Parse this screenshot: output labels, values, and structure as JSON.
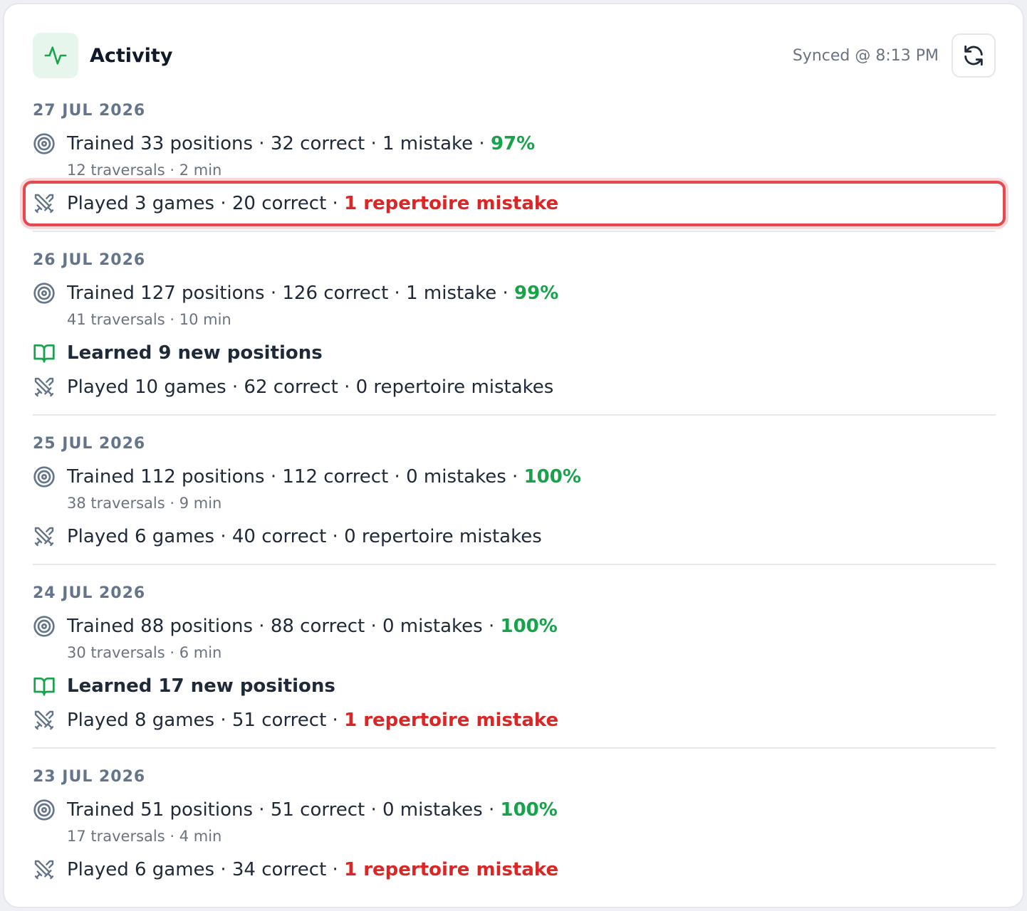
{
  "header": {
    "title": "Activity",
    "sync_text": "Synced @ 8:13 PM",
    "icon": "activity-pulse-icon",
    "refresh_icon": "refresh-icon"
  },
  "colors": {
    "good": "#16a34a",
    "bad": "#dc2626",
    "highlight": "#e5484d"
  },
  "days": [
    {
      "date": "27 JUL 2026",
      "trained": {
        "main": "Trained 33 positions · 32 correct · 1 mistake · ",
        "pct": "97%",
        "sub": "12 traversals · 2 min"
      },
      "played": {
        "main": "Played 3 games · 20 correct · ",
        "mistakes": "1 repertoire mistake",
        "has_mistake": true,
        "highlighted": true
      }
    },
    {
      "date": "26 JUL 2026",
      "trained": {
        "main": "Trained 127 positions · 126 correct · 1 mistake · ",
        "pct": "99%",
        "sub": "41 traversals · 10 min"
      },
      "learned": "Learned 9 new positions",
      "played": {
        "main": "Played 10 games · 62 correct · ",
        "mistakes": "0 repertoire mistakes",
        "has_mistake": false
      }
    },
    {
      "date": "25 JUL 2026",
      "trained": {
        "main": "Trained 112 positions · 112 correct · 0 mistakes · ",
        "pct": "100%",
        "sub": "38 traversals · 9 min"
      },
      "played": {
        "main": "Played 6 games · 40 correct · ",
        "mistakes": "0 repertoire mistakes",
        "has_mistake": false
      }
    },
    {
      "date": "24 JUL 2026",
      "trained": {
        "main": "Trained 88 positions · 88 correct · 0 mistakes · ",
        "pct": "100%",
        "sub": "30 traversals · 6 min"
      },
      "learned": "Learned 17 new positions",
      "played": {
        "main": "Played 8 games · 51 correct · ",
        "mistakes": "1 repertoire mistake",
        "has_mistake": true
      }
    },
    {
      "date": "23 JUL 2026",
      "trained": {
        "main": "Trained 51 positions · 51 correct · 0 mistakes · ",
        "pct": "100%",
        "sub": "17 traversals · 4 min"
      },
      "played": {
        "main": "Played 6 games · 34 correct · ",
        "mistakes": "1 repertoire mistake",
        "has_mistake": true
      }
    }
  ]
}
